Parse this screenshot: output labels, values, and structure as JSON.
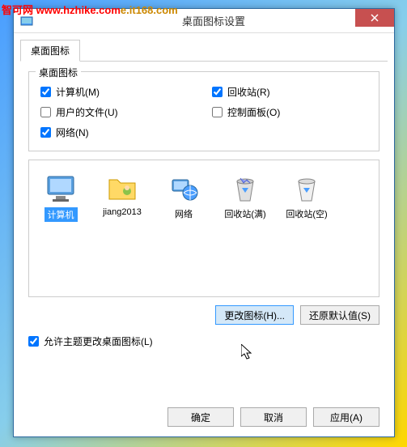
{
  "watermark": {
    "site1": "智可网",
    "url1": "www.hzhike.com",
    "url2": "e.it168.com"
  },
  "titlebar": {
    "title": "桌面图标设置"
  },
  "tab": {
    "label": "桌面图标"
  },
  "groupbox": {
    "title": "桌面图标"
  },
  "checks": {
    "computer": {
      "label": "计算机(M)",
      "checked": true
    },
    "recycle": {
      "label": "回收站(R)",
      "checked": true
    },
    "userfiles": {
      "label": "用户的文件(U)",
      "checked": false
    },
    "controlpanel": {
      "label": "控制面板(O)",
      "checked": false
    },
    "network": {
      "label": "网络(N)",
      "checked": true
    }
  },
  "icons": {
    "computer": "计算机",
    "user": "jiang2013",
    "network": "网络",
    "recycle_full": "回收站(满)",
    "recycle_empty": "回收站(空)"
  },
  "buttons": {
    "change_icon": "更改图标(H)...",
    "restore_default": "还原默认值(S)",
    "ok": "确定",
    "cancel": "取消",
    "apply": "应用(A)"
  },
  "allow_theme": {
    "label": "允许主题更改桌面图标(L)",
    "checked": true
  }
}
